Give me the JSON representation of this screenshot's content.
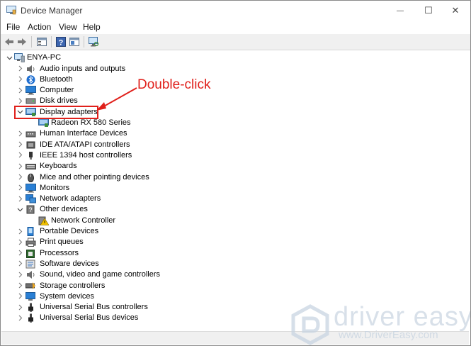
{
  "window": {
    "title": "Device Manager",
    "minimize": "—",
    "maximize": "☐",
    "close": "✕"
  },
  "menu": [
    {
      "label": "File"
    },
    {
      "label": "Action"
    },
    {
      "label": "View"
    },
    {
      "label": "Help"
    }
  ],
  "toolbar": {
    "icons": [
      "back-arrow-icon",
      "forward-arrow-icon",
      "properties-icon",
      "help-icon",
      "view-icon",
      "scan-hardware-icon"
    ]
  },
  "tree": {
    "root": {
      "label": "ENYA-PC",
      "expanded": true
    },
    "categories": [
      {
        "label": "Audio inputs and outputs",
        "expanded": false,
        "icon": "speaker-icon"
      },
      {
        "label": "Bluetooth",
        "expanded": false,
        "icon": "bluetooth-icon"
      },
      {
        "label": "Computer",
        "expanded": false,
        "icon": "monitor-icon"
      },
      {
        "label": "Disk drives",
        "expanded": false,
        "icon": "disk-drive-icon"
      },
      {
        "label": "Display adapters",
        "expanded": true,
        "icon": "display-adapter-icon",
        "children": [
          {
            "label": "Radeon RX 580 Series",
            "icon": "display-adapter-icon"
          }
        ]
      },
      {
        "label": "Human Interface Devices",
        "expanded": false,
        "icon": "hid-icon"
      },
      {
        "label": "IDE ATA/ATAPI controllers",
        "expanded": false,
        "icon": "ide-controller-icon"
      },
      {
        "label": "IEEE 1394 host controllers",
        "expanded": false,
        "icon": "ieee1394-icon"
      },
      {
        "label": "Keyboards",
        "expanded": false,
        "icon": "keyboard-icon"
      },
      {
        "label": "Mice and other pointing devices",
        "expanded": false,
        "icon": "mouse-icon"
      },
      {
        "label": "Monitors",
        "expanded": false,
        "icon": "monitor-icon"
      },
      {
        "label": "Network adapters",
        "expanded": false,
        "icon": "network-adapter-icon"
      },
      {
        "label": "Other devices",
        "expanded": true,
        "icon": "unknown-device-icon",
        "children": [
          {
            "label": "Network Controller",
            "icon": "warning-device-icon"
          }
        ]
      },
      {
        "label": "Portable Devices",
        "expanded": false,
        "icon": "portable-device-icon"
      },
      {
        "label": "Print queues",
        "expanded": false,
        "icon": "printer-icon"
      },
      {
        "label": "Processors",
        "expanded": false,
        "icon": "processor-icon"
      },
      {
        "label": "Software devices",
        "expanded": false,
        "icon": "software-device-icon"
      },
      {
        "label": "Sound, video and game controllers",
        "expanded": false,
        "icon": "speaker-icon"
      },
      {
        "label": "Storage controllers",
        "expanded": false,
        "icon": "storage-controller-icon"
      },
      {
        "label": "System devices",
        "expanded": false,
        "icon": "system-device-icon"
      },
      {
        "label": "Universal Serial Bus controllers",
        "expanded": false,
        "icon": "usb-icon"
      },
      {
        "label": "Universal Serial Bus devices",
        "expanded": false,
        "icon": "usb-icon"
      }
    ]
  },
  "annotation": {
    "text": "Double-click",
    "color": "#e0201b"
  },
  "watermark": {
    "brand": "driver easy",
    "url": "www.DriverEasy.com"
  },
  "colors": {
    "accent": "#e0201b",
    "icon_blue": "#2a7fd4",
    "selection": "#cce8ff"
  }
}
